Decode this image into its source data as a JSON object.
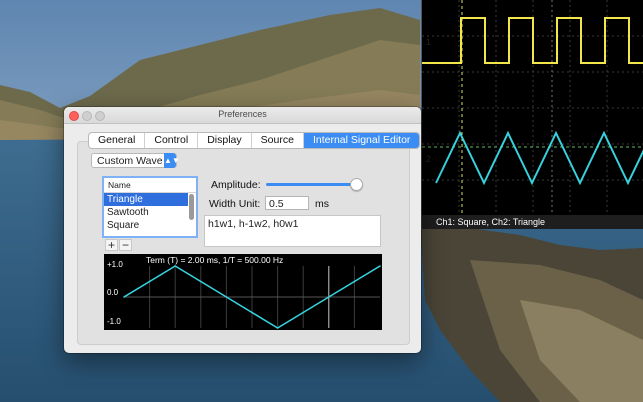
{
  "preferences": {
    "title": "Preferences",
    "tabs": [
      {
        "label": "General"
      },
      {
        "label": "Control"
      },
      {
        "label": "Display"
      },
      {
        "label": "Source"
      },
      {
        "label": "Internal Signal Editor",
        "active": true
      }
    ],
    "wave_mode": "Custom Wave",
    "list": {
      "header": "Name",
      "items": [
        "Triangle",
        "Sawtooth",
        "Square"
      ],
      "selected": "Triangle",
      "add_label": "+",
      "remove_label": "−"
    },
    "amplitude": {
      "label": "Amplitude:",
      "value_fraction": 0.95
    },
    "width_unit": {
      "label": "Width Unit:",
      "value": "0.5",
      "unit": "ms"
    },
    "formula": "h1w1, h-1w2, h0w1",
    "plot": {
      "header": "Term (T) = 2.00 ms,     1/T = 500.00 Hz",
      "y_ticks": [
        "+1.0",
        "0.0",
        "-1.0"
      ]
    }
  },
  "scope": {
    "status": "Ch1: Square, Ch2: Triangle",
    "ch1_label": "1",
    "ch2_label": "2"
  },
  "colors": {
    "accent": "#3c8df3",
    "ch1": "#f3e64a",
    "ch2": "#37d3df",
    "plot_wave": "#37d3df"
  },
  "chart_data": {
    "type": "line",
    "x": [
      0,
      0.5,
      1.0,
      1.5,
      2.0,
      2.5,
      3.0,
      3.5,
      4.0,
      4.5,
      5.0
    ],
    "series": [
      {
        "values": [
          0,
          0.5,
          1.0,
          0.5,
          0,
          -0.5,
          -1.0,
          -0.5,
          0,
          0.5,
          1.0
        ]
      }
    ],
    "ylim": [
      -1.0,
      1.0
    ],
    "title": "Term (T) = 2.00 ms,     1/T = 500.00 Hz"
  }
}
